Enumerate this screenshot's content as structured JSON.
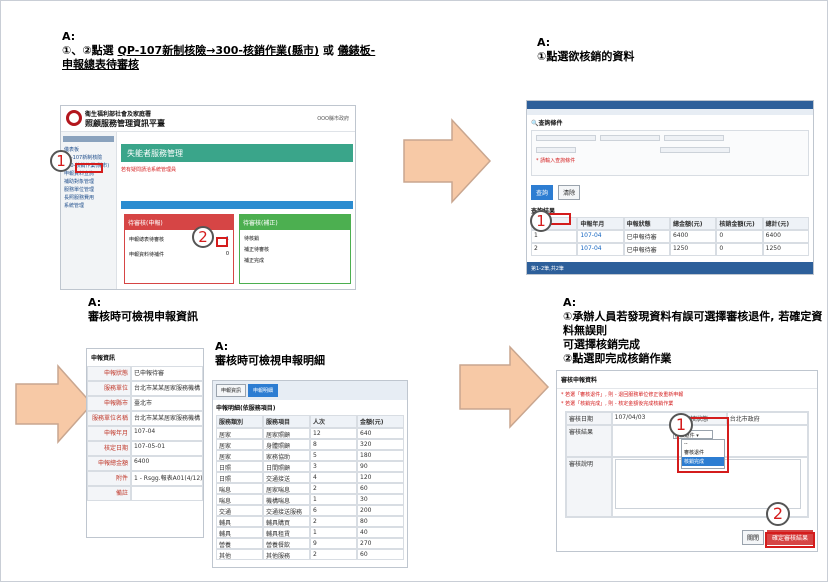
{
  "panel_tl": {
    "caption_a": "A:",
    "caption_1_pre": "①、②點選 ",
    "caption_1_link": "QP-107新制核險→300-核銷作業(縣市)",
    "caption_1_mid": " 或 ",
    "caption_1_link2": "儀錶板-",
    "caption_2_link": "申報總表待審核",
    "app_title": "衛生福利部社會及家庭署",
    "app_sub": "照顧服務管理資訊平臺",
    "header_right": "OOO縣市政府",
    "menu_items": [
      "儀表板",
      "QP-107新制核險",
      "300-核銷作業(縣市)",
      "申報資料查詢",
      "補助對象管理",
      "服務單位管理",
      "長照服務費用",
      "系統管理"
    ],
    "main_title": "失能者服務管理",
    "red_notice": "若有疑問請洽系統管理員",
    "left_card_title": "待審核(申報)",
    "right_card_title": "待審核(補正)",
    "left_card_rows": [
      "申報總表待審核",
      "申報資料待補件"
    ],
    "left_card_vals": [
      "1",
      "0"
    ],
    "right_card_rows": [
      "待核銷",
      "補正待審核",
      "補正完成"
    ],
    "badge1": "1",
    "badge2": "2"
  },
  "panel_tr": {
    "caption_a": "A:",
    "caption_1": "①點選欲核銷的資料",
    "search_label": "查詢條件",
    "query_btn": "查詢",
    "clear_btn": "清除",
    "table_title": "查詢結果",
    "col_headers": [
      "序號",
      "申報年月",
      "申報狀態",
      "總金額(元)",
      "核銷金額(元)",
      "總計(元)"
    ],
    "rows": [
      [
        "1",
        "107-04",
        "已申報待審",
        "6400",
        "0",
        "6400"
      ],
      [
        "2",
        "107-04",
        "已申報待審",
        "1250",
        "0",
        "1250"
      ]
    ],
    "pager": "第1-2筆,共2筆",
    "badge1": "1"
  },
  "panel_bl": {
    "caption_a": "A:",
    "caption_1": "審核時可檢視申報資訊",
    "section_title": "申報資訊",
    "fields": [
      [
        "申報狀態",
        "已申報待審"
      ],
      [
        "服務單位",
        "台北市某某居家服務機構"
      ],
      [
        "申報縣市",
        "臺北市"
      ],
      [
        "服務單位名稱",
        "台北市某某居家服務機構"
      ],
      [
        "申報年月",
        "107-04"
      ],
      [
        "核定日期",
        "107-05-01"
      ],
      [
        "申報總金額",
        "6400"
      ],
      [
        "附件",
        "1 - Rsgg.報表A01(4/12)"
      ],
      [
        "備註",
        ""
      ]
    ]
  },
  "panel_bm": {
    "caption_a": "A:",
    "caption_1": "審核時可檢視申報明細",
    "tab1": "申報資訊",
    "tab2": "申報明細",
    "section_title": "申報明細(依服務項目)",
    "cols": [
      "服務類別",
      "服務項目",
      "人次",
      "金額(元)"
    ],
    "rows": [
      [
        "居家",
        "居家照顧",
        "12",
        "640"
      ],
      [
        "居家",
        "身體照顧",
        "8",
        "320"
      ],
      [
        "居家",
        "家務協助",
        "5",
        "180"
      ],
      [
        "日照",
        "日間照顧",
        "3",
        "90"
      ],
      [
        "日照",
        "交通接送",
        "4",
        "120"
      ],
      [
        "喘息",
        "居家喘息",
        "2",
        "60"
      ],
      [
        "喘息",
        "機構喘息",
        "1",
        "30"
      ],
      [
        "交通",
        "交通接送服務",
        "6",
        "200"
      ],
      [
        "輔具",
        "輔具購買",
        "2",
        "80"
      ],
      [
        "輔具",
        "輔具租賃",
        "1",
        "40"
      ],
      [
        "營養",
        "營養餐飲",
        "9",
        "270"
      ],
      [
        "其他",
        "其他服務",
        "2",
        "60"
      ]
    ]
  },
  "panel_br": {
    "caption_a": "A:",
    "caption_1": "①承辦人員若發現資料有誤可選擇審核退件, 若確定資料無誤則",
    "caption_2": "可選擇核銷完成",
    "caption_3": "②點選即完成核銷作業",
    "dialog_title": "審核申報資料",
    "note1": "* 若選「審核退件」, 則 - 退回服務單位修正後重新申報",
    "note2": "* 若選「核銷完成」, 則 - 核定金額後完成核銷作業",
    "label_date": "審核日期",
    "date_val": "107/04/03",
    "label_status": "審核狀態",
    "status_val": "審核退件",
    "label_unit": "審核單位",
    "unit_val": "台北市政府",
    "label_result": "審核結果",
    "label_note": "審核說明",
    "options": [
      "--",
      "審核退件",
      "核銷完成"
    ],
    "close_btn": "關閉",
    "confirm_btn": "確定審核結果",
    "badge1": "1",
    "badge2": "2"
  },
  "colors": {
    "arrow_fill": "#f7c9a6",
    "arrow_stroke": "#c9a68f",
    "accent_red": "#d41c1c",
    "teal": "#3aa58a",
    "blue": "#2b8cd0"
  }
}
